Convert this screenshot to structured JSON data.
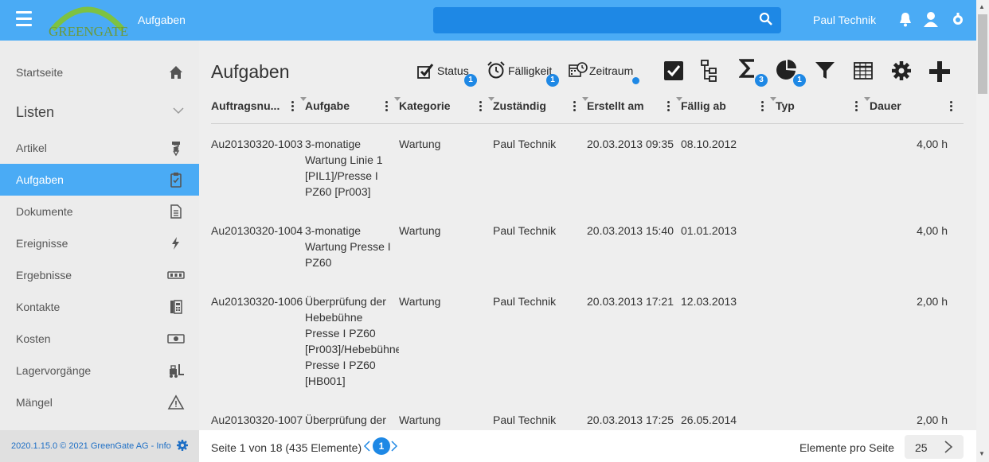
{
  "header": {
    "logo_text": "GREENGATE",
    "title": "Aufgaben",
    "search": {
      "value": "",
      "placeholder": ""
    },
    "user": "Paul Technik"
  },
  "sidebar": {
    "items": [
      {
        "label": "Startseite",
        "icon": "home-icon"
      },
      {
        "label": "Listen",
        "icon": "chevron-down-icon",
        "section": true
      },
      {
        "label": "Artikel",
        "icon": "screw-icon"
      },
      {
        "label": "Aufgaben",
        "icon": "clipboard-check-icon",
        "active": true
      },
      {
        "label": "Dokumente",
        "icon": "document-icon"
      },
      {
        "label": "Ereignisse",
        "icon": "lightning-icon"
      },
      {
        "label": "Ergebnisse",
        "icon": "counter-icon"
      },
      {
        "label": "Kontakte",
        "icon": "address-book-icon"
      },
      {
        "label": "Kosten",
        "icon": "money-icon"
      },
      {
        "label": "Lagervorgänge",
        "icon": "forklift-icon"
      },
      {
        "label": "Mängel",
        "icon": "warning-icon"
      }
    ],
    "footer": "2020.1.15.0 © 2021 GreenGate AG - Info"
  },
  "main": {
    "title": "Aufgaben",
    "toolbar": {
      "status": {
        "label": "Status",
        "badge": "1"
      },
      "faelligkeit": {
        "label": "Fälligkeit",
        "badge": "1"
      },
      "zeitraum": {
        "label": "Zeitraum"
      },
      "sum_badge": "3",
      "chart_badge": "1"
    },
    "columns": [
      "Auftragsnu...",
      "Aufgabe",
      "Kategorie",
      "Zuständig",
      "Erstellt am",
      "Fällig ab",
      "Typ",
      "Dauer"
    ],
    "rows": [
      {
        "nr": "Au20130320-1003",
        "task": [
          "3-monatige",
          "Wartung Linie 1",
          "[PIL1]/Presse I",
          "PZ60 [Pr003]"
        ],
        "kategorie": "Wartung",
        "zustaendig": "Paul Technik",
        "erstellt": "20.03.2013 09:35",
        "faellig": "08.10.2012",
        "typ": "",
        "dauer": "4,00 h"
      },
      {
        "nr": "Au20130320-1004",
        "task": [
          "3-monatige",
          "Wartung Presse I",
          "PZ60"
        ],
        "kategorie": "Wartung",
        "zustaendig": "Paul Technik",
        "erstellt": "20.03.2013 15:40",
        "faellig": "01.01.2013",
        "typ": "",
        "dauer": "4,00 h"
      },
      {
        "nr": "Au20130320-1006",
        "task": [
          "Überprüfung der",
          "Hebebühne",
          "Presse I PZ60",
          "[Pr003]/Hebebühne",
          "Presse I PZ60",
          "[HB001]"
        ],
        "kategorie": "Wartung",
        "zustaendig": "Paul Technik",
        "erstellt": "20.03.2013 17:21",
        "faellig": "12.03.2013",
        "typ": "",
        "dauer": "2,00 h"
      },
      {
        "nr": "Au20130320-1007",
        "task": [
          "Überprüfung der"
        ],
        "kategorie": "Wartung",
        "zustaendig": "Paul Technik",
        "erstellt": "20.03.2013 17:25",
        "faellig": "26.05.2014",
        "typ": "",
        "dauer": "2,00 h"
      }
    ]
  },
  "pager": {
    "info": "Seite 1 von 18 (435 Elemente)",
    "current": "1",
    "per_page_label": "Elemente pro Seite",
    "per_page": "25"
  },
  "colors": {
    "primary": "#4aabf5",
    "accent": "#1e88e5",
    "logo_green": "#6b9a3a"
  }
}
